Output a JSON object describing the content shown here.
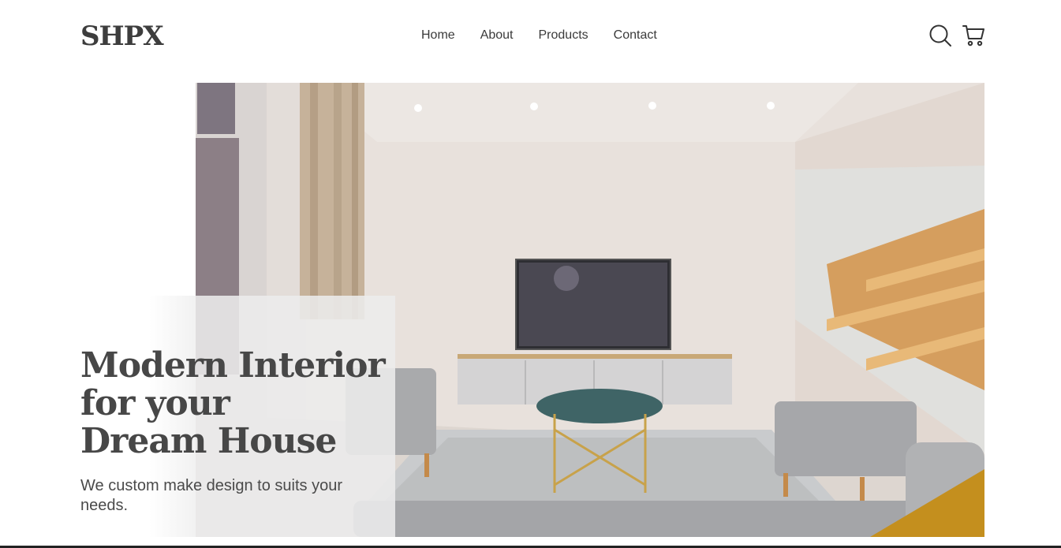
{
  "header": {
    "logo": "SHPX",
    "nav": [
      {
        "label": "Home"
      },
      {
        "label": "About"
      },
      {
        "label": "Products"
      },
      {
        "label": "Contact"
      }
    ],
    "icons": {
      "search": "search-icon",
      "cart": "cart-icon"
    }
  },
  "hero": {
    "title_lines": [
      "Modern Interior",
      "for your",
      "Dream House"
    ],
    "subtitle": "We custom make design to suits your needs.",
    "image": "living-room-photo"
  },
  "colors": {
    "text": "#474747",
    "accent_gold": "#c8a24a",
    "wood": "#d9a868",
    "sofa_gray": "#a8a9ab"
  }
}
